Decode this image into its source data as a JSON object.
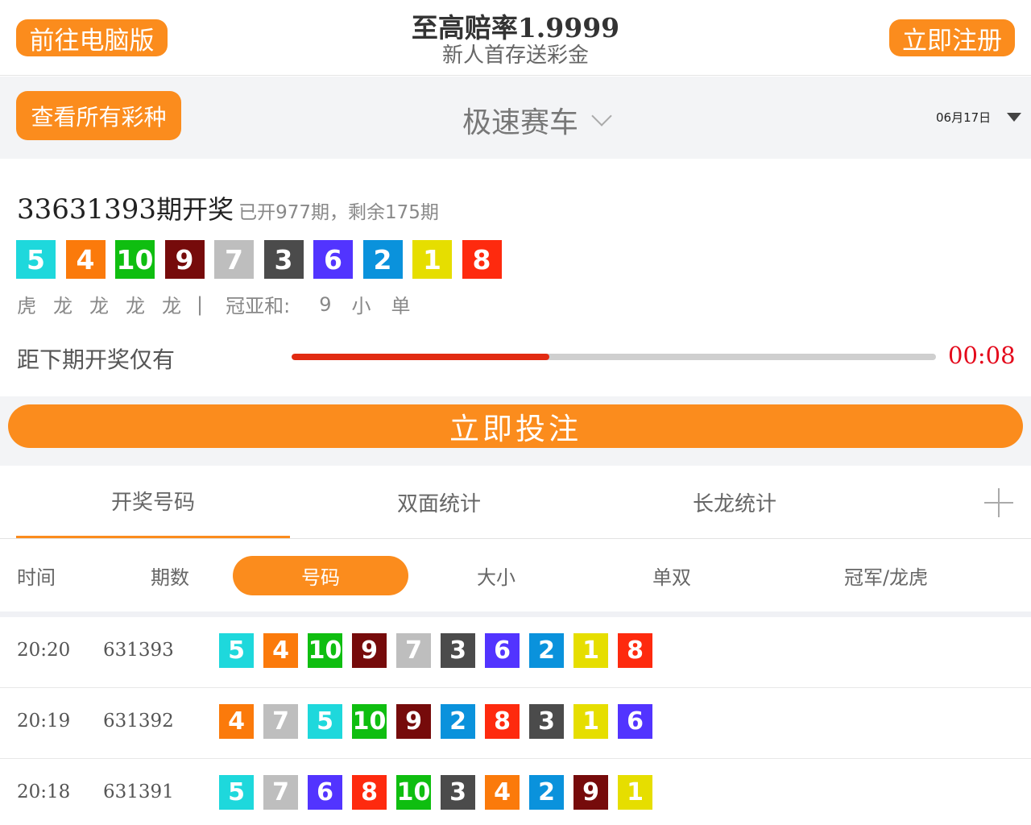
{
  "header": {
    "pc_button": "前往电脑版",
    "promo_title": "至高赔率1.9999",
    "promo_subtitle": "新人首存送彩金",
    "register_button": "立即注册"
  },
  "selector": {
    "all_lotteries_button": "查看所有彩种",
    "game_name": "极速赛车",
    "date": "06月17日"
  },
  "draw": {
    "issue": "33631393",
    "issue_suffix": "期开奖",
    "progress_text": "已开977期，剩余175期",
    "numbers": [
      5,
      4,
      10,
      9,
      7,
      3,
      6,
      2,
      1,
      8
    ],
    "dragon_tiger": [
      "虎",
      "龙",
      "龙",
      "龙",
      "龙"
    ],
    "separator": "|",
    "guanya_label": "冠亚和:",
    "guanya_sum": "9",
    "guanya_size": "小",
    "guanya_parity": "单",
    "countdown_label": "距下期开奖仅有",
    "countdown": "00:08",
    "countdown_progress": 0.4
  },
  "bet_button": "立即投注",
  "tabs": [
    "开奖号码",
    "双面统计",
    "长龙统计"
  ],
  "active_tab": 0,
  "filters": {
    "time": "时间",
    "issue": "期数",
    "number": "号码",
    "size": "大小",
    "parity": "单双",
    "champion_dragon": "冠军/龙虎"
  },
  "ball_colors": {
    "1": "#e6de00",
    "2": "#0a92dc",
    "3": "#4b4b4b",
    "4": "#fb7a0b",
    "5": "#1ed8dc",
    "6": "#5234ff",
    "7": "#bebebe",
    "8": "#fe2a0e",
    "9": "#760b0b",
    "10": "#0fbe10"
  },
  "history": [
    {
      "time": "20:20",
      "issue": "631393",
      "numbers": [
        5,
        4,
        10,
        9,
        7,
        3,
        6,
        2,
        1,
        8
      ]
    },
    {
      "time": "20:19",
      "issue": "631392",
      "numbers": [
        4,
        7,
        5,
        10,
        9,
        2,
        8,
        3,
        1,
        6
      ]
    },
    {
      "time": "20:18",
      "issue": "631391",
      "numbers": [
        5,
        7,
        6,
        8,
        10,
        3,
        4,
        2,
        9,
        1
      ]
    }
  ]
}
